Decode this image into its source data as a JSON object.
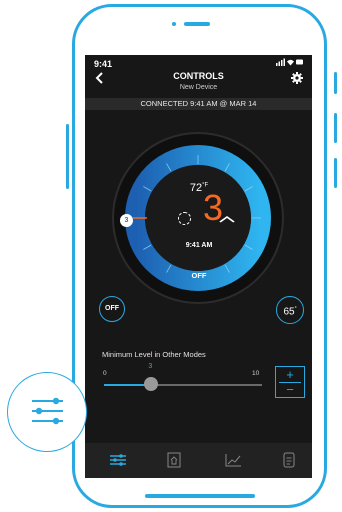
{
  "status_bar": {
    "time": "9:41",
    "system_icons": "signal-wifi-battery-icons"
  },
  "header": {
    "title": "CONTROLS",
    "subtitle": "New Device",
    "back_icon": "chevron-left-icon",
    "settings_icon": "gear-icon"
  },
  "connection": {
    "text": "CONNECTED  9:41 AM @ MAR 14"
  },
  "dial": {
    "current_temp": "72",
    "temp_unit": "°F",
    "setpoint": "3",
    "time": "9:41 AM",
    "mode": "OFF",
    "marker_value": "3",
    "colors": {
      "ring_dark": "#1d5fb0",
      "ring_light": "#2fb6f0",
      "setpoint": "#f46a22"
    }
  },
  "controls": {
    "off_button": "OFF",
    "temp_value": "65",
    "temp_sup": "°"
  },
  "min_level": {
    "label": "Minimum Level in Other Modes",
    "min": "0",
    "max": "10",
    "value": "3",
    "value_fraction": 0.3
  },
  "stepper": {
    "plus": "+",
    "minus": "−"
  },
  "tabbar": {
    "tabs": [
      "sliders-icon",
      "building-icon",
      "chart-line-icon",
      "document-icon"
    ],
    "active_index": 0
  },
  "floating_icon": "sliders-icon",
  "accent_color": "#29a9e1"
}
